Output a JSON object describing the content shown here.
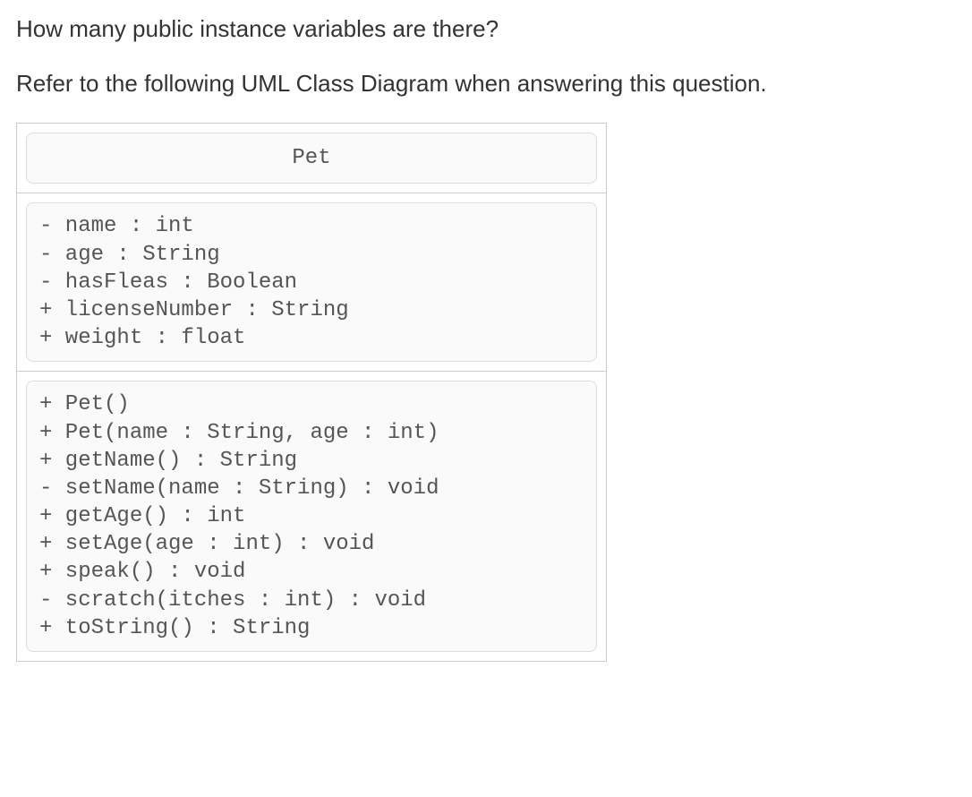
{
  "question": {
    "line1": "How many public instance variables are there?",
    "line2": "Refer to the following UML Class Diagram when answering this question."
  },
  "uml": {
    "className": "Pet",
    "attributes": [
      "- name : int",
      "- age : String",
      "- hasFleas : Boolean",
      "+ licenseNumber : String",
      "+ weight : float"
    ],
    "methods": [
      "+ Pet()",
      "+ Pet(name : String, age : int)",
      "+ getName() : String",
      "- setName(name : String) : void",
      "+ getAge() : int",
      "+ setAge(age : int) : void",
      "+ speak() : void",
      "- scratch(itches : int) : void",
      "+ toString() : String"
    ]
  }
}
